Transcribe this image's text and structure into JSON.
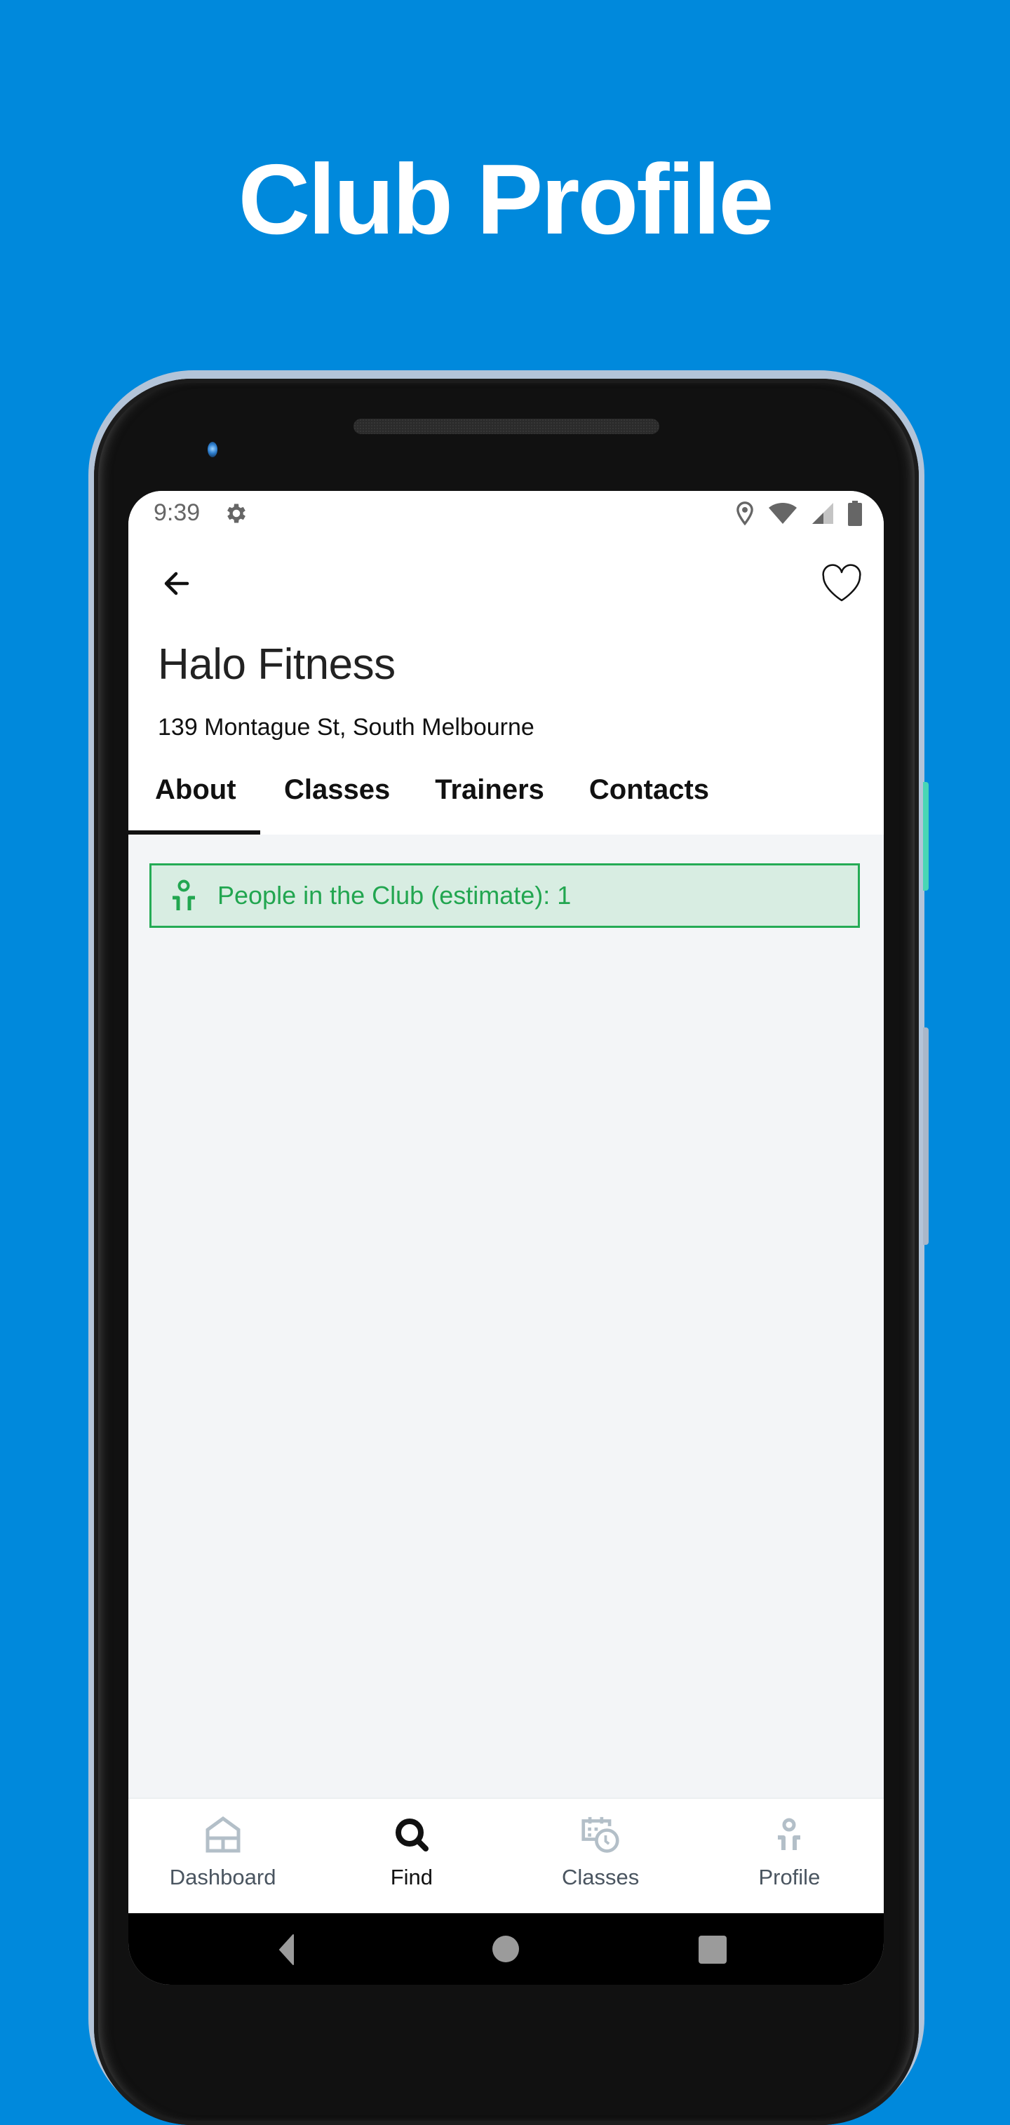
{
  "headline": "Club Profile",
  "status_bar": {
    "time": "9:39",
    "icons": [
      "gear-icon",
      "location-icon",
      "wifi-icon",
      "signal-icon",
      "battery-icon"
    ]
  },
  "header": {
    "back_icon": "arrow-left-icon",
    "favorite_icon": "heart-outline-icon",
    "club_name": "Halo Fitness",
    "address": "139 Montague St, South Melbourne"
  },
  "tabs": [
    {
      "label": "About",
      "active": true
    },
    {
      "label": "Classes",
      "active": false
    },
    {
      "label": "Trainers",
      "active": false
    },
    {
      "label": "Contacts",
      "active": false
    }
  ],
  "info_box": {
    "icon": "person-icon",
    "text": "People in the Club (estimate): 1",
    "color": "#22a650",
    "background": "#d8ede2"
  },
  "bottom_nav": [
    {
      "label": "Dashboard",
      "icon": "home-icon",
      "active": false
    },
    {
      "label": "Find",
      "icon": "search-icon",
      "active": true
    },
    {
      "label": "Classes",
      "icon": "calendar-clock-icon",
      "active": false
    },
    {
      "label": "Profile",
      "icon": "person-icon",
      "active": false
    }
  ],
  "colors": {
    "background": "#0089dc",
    "accent_green": "#25ab55",
    "inactive_icon": "#b3bfc8",
    "active_icon": "#111111"
  }
}
